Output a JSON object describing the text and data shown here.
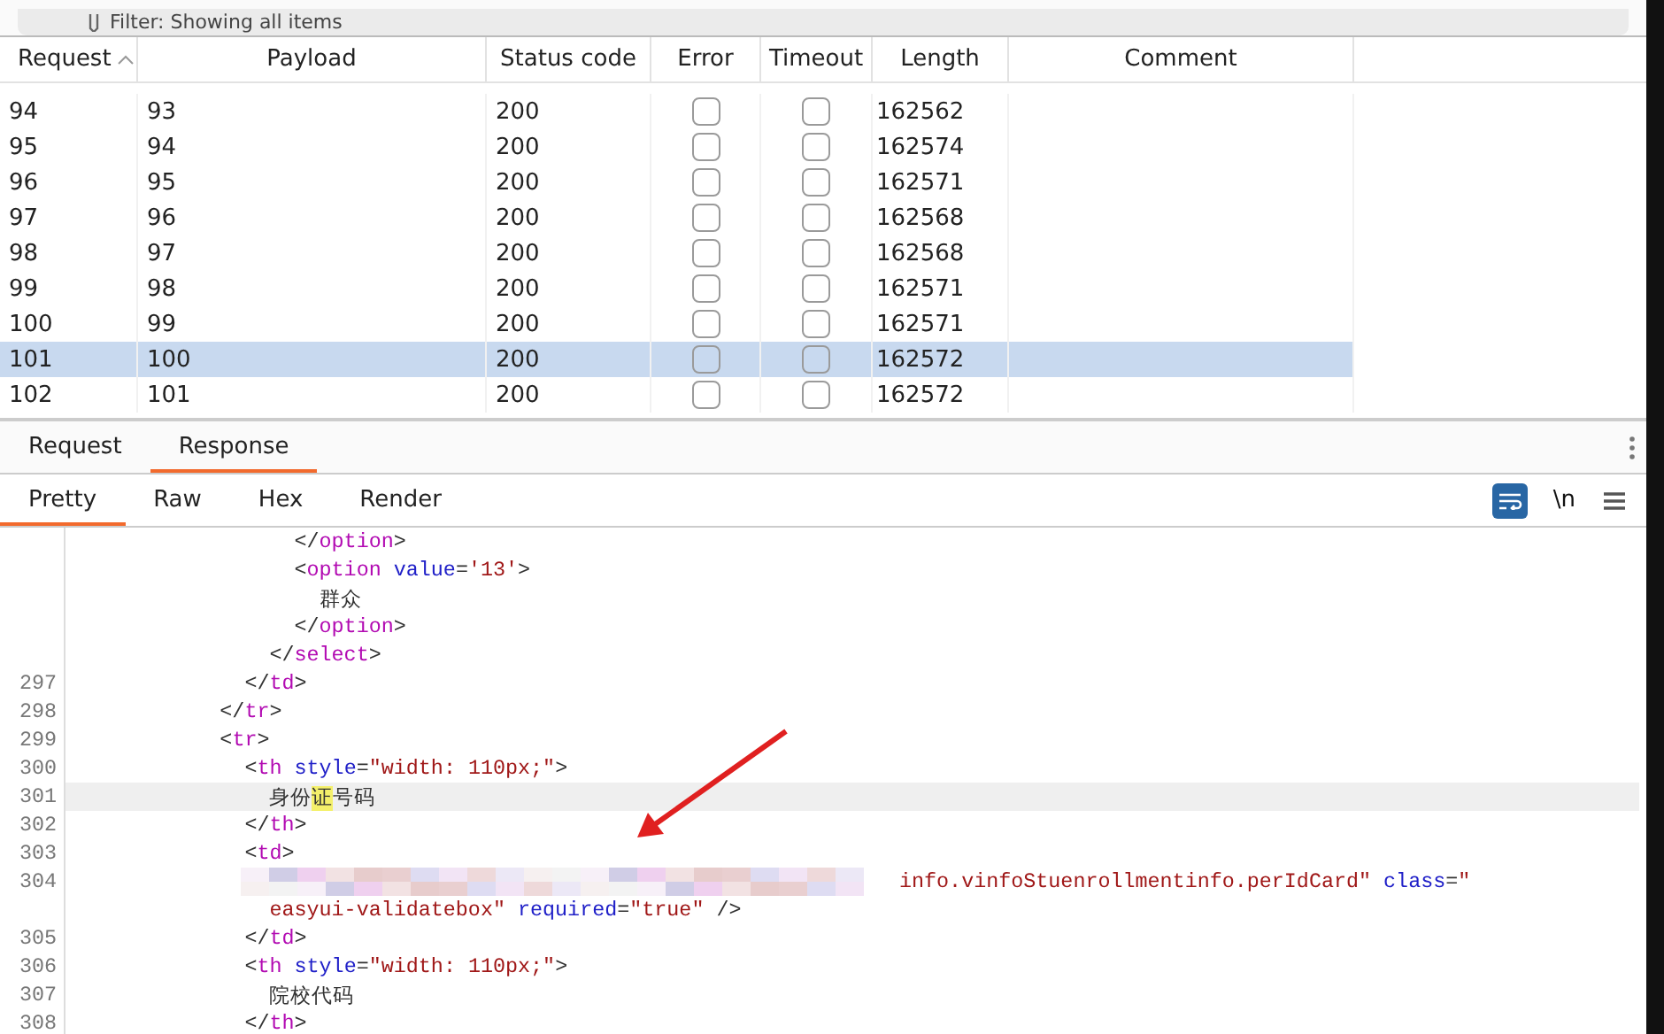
{
  "filter_bar": {
    "text": "Filter: Showing all items"
  },
  "table": {
    "columns": [
      {
        "label": "Request",
        "sorted": true
      },
      {
        "label": "Payload",
        "sorted": false
      },
      {
        "label": "Status code",
        "sorted": false
      },
      {
        "label": "Error",
        "sorted": false
      },
      {
        "label": "Timeout",
        "sorted": false
      },
      {
        "label": "Length",
        "sorted": false
      },
      {
        "label": "Comment",
        "sorted": false
      }
    ],
    "rows": [
      {
        "request": "94",
        "payload": "93",
        "status": "200",
        "error": false,
        "timeout": false,
        "length": "162562",
        "selected": false
      },
      {
        "request": "95",
        "payload": "94",
        "status": "200",
        "error": false,
        "timeout": false,
        "length": "162574",
        "selected": false
      },
      {
        "request": "96",
        "payload": "95",
        "status": "200",
        "error": false,
        "timeout": false,
        "length": "162571",
        "selected": false
      },
      {
        "request": "97",
        "payload": "96",
        "status": "200",
        "error": false,
        "timeout": false,
        "length": "162568",
        "selected": false
      },
      {
        "request": "98",
        "payload": "97",
        "status": "200",
        "error": false,
        "timeout": false,
        "length": "162568",
        "selected": false
      },
      {
        "request": "99",
        "payload": "98",
        "status": "200",
        "error": false,
        "timeout": false,
        "length": "162571",
        "selected": false
      },
      {
        "request": "100",
        "payload": "99",
        "status": "200",
        "error": false,
        "timeout": false,
        "length": "162571",
        "selected": false
      },
      {
        "request": "101",
        "payload": "100",
        "status": "200",
        "error": false,
        "timeout": false,
        "length": "162572",
        "selected": true
      },
      {
        "request": "102",
        "payload": "101",
        "status": "200",
        "error": false,
        "timeout": false,
        "length": "162572",
        "selected": false
      }
    ]
  },
  "message_tabs": [
    {
      "label": "Request",
      "selected": false
    },
    {
      "label": "Response",
      "selected": true
    }
  ],
  "view_tabs": [
    {
      "label": "Pretty",
      "selected": true
    },
    {
      "label": "Raw",
      "selected": false
    },
    {
      "label": "Hex",
      "selected": false
    },
    {
      "label": "Render",
      "selected": false
    }
  ],
  "view_toolbar": {
    "wrap_lines": {
      "on": true
    },
    "newline_toggle": {
      "label": "\\n",
      "on": false
    }
  },
  "code_lines": [
    {
      "current": false,
      "tokens": [
        {
          "kind": "punct",
          "text": "                  </"
        },
        {
          "kind": "tag",
          "text": "option"
        },
        {
          "kind": "punct",
          "text": ">"
        }
      ]
    },
    {
      "current": false,
      "tokens": [
        {
          "kind": "punct",
          "text": "                  <"
        },
        {
          "kind": "tag",
          "text": "option"
        },
        {
          "kind": "attr",
          "text": " value"
        },
        {
          "kind": "punct",
          "text": "="
        },
        {
          "kind": "value",
          "text": "'13'"
        },
        {
          "kind": "punct",
          "text": ">"
        }
      ]
    },
    {
      "current": false,
      "tokens": [
        {
          "kind": "plain",
          "text": "                    群众"
        }
      ]
    },
    {
      "current": false,
      "tokens": [
        {
          "kind": "punct",
          "text": "                  </"
        },
        {
          "kind": "tag",
          "text": "option"
        },
        {
          "kind": "punct",
          "text": ">"
        }
      ]
    },
    {
      "current": false,
      "tokens": [
        {
          "kind": "punct",
          "text": "                </"
        },
        {
          "kind": "tag",
          "text": "select"
        },
        {
          "kind": "punct",
          "text": ">"
        }
      ]
    },
    {
      "number": "297",
      "current": false,
      "tokens": [
        {
          "kind": "punct",
          "text": "              </"
        },
        {
          "kind": "tag",
          "text": "td"
        },
        {
          "kind": "punct",
          "text": ">"
        }
      ]
    },
    {
      "number": "298",
      "current": false,
      "tokens": [
        {
          "kind": "punct",
          "text": "            </"
        },
        {
          "kind": "tag",
          "text": "tr"
        },
        {
          "kind": "punct",
          "text": ">"
        }
      ]
    },
    {
      "number": "299",
      "current": false,
      "tokens": [
        {
          "kind": "punct",
          "text": "            <"
        },
        {
          "kind": "tag",
          "text": "tr"
        },
        {
          "kind": "punct",
          "text": ">"
        }
      ]
    },
    {
      "number": "300",
      "current": false,
      "tokens": [
        {
          "kind": "punct",
          "text": "              <"
        },
        {
          "kind": "tag",
          "text": "th"
        },
        {
          "kind": "attr",
          "text": " style"
        },
        {
          "kind": "punct",
          "text": "="
        },
        {
          "kind": "value",
          "text": "\"width: 110px;\""
        },
        {
          "kind": "punct",
          "text": ">"
        }
      ]
    },
    {
      "number": "301",
      "current": true,
      "tokens": [
        {
          "kind": "plain",
          "text": "                身份"
        },
        {
          "kind": "match",
          "text": "证"
        },
        {
          "kind": "plain",
          "text": "号码"
        }
      ]
    },
    {
      "number": "302",
      "current": false,
      "tokens": [
        {
          "kind": "punct",
          "text": "              </"
        },
        {
          "kind": "tag",
          "text": "th"
        },
        {
          "kind": "punct",
          "text": ">"
        }
      ]
    },
    {
      "number": "303",
      "current": false,
      "tokens": [
        {
          "kind": "punct",
          "text": "              <"
        },
        {
          "kind": "tag",
          "text": "td"
        },
        {
          "kind": "punct",
          "text": ">"
        }
      ]
    },
    {
      "number": "304",
      "current": false,
      "tokens": [
        {
          "kind": "redacted"
        },
        {
          "kind": "value",
          "text": "info.vinfoStuenrollmentinfo.perIdCard\""
        },
        {
          "kind": "attr",
          "text": " class"
        },
        {
          "kind": "punct",
          "text": "="
        },
        {
          "kind": "value",
          "text": "\""
        }
      ]
    },
    {
      "current": false,
      "tokens": [
        {
          "kind": "value",
          "text": "                easyui-validatebox\""
        },
        {
          "kind": "attr",
          "text": " required"
        },
        {
          "kind": "punct",
          "text": "="
        },
        {
          "kind": "value",
          "text": "\"true\""
        },
        {
          "kind": "punct",
          "text": " />"
        }
      ]
    },
    {
      "number": "305",
      "current": false,
      "tokens": [
        {
          "kind": "punct",
          "text": "              </"
        },
        {
          "kind": "tag",
          "text": "td"
        },
        {
          "kind": "punct",
          "text": ">"
        }
      ]
    },
    {
      "number": "306",
      "current": false,
      "tokens": [
        {
          "kind": "punct",
          "text": "              <"
        },
        {
          "kind": "tag",
          "text": "th"
        },
        {
          "kind": "attr",
          "text": " style"
        },
        {
          "kind": "punct",
          "text": "="
        },
        {
          "kind": "value",
          "text": "\"width: 110px;\""
        },
        {
          "kind": "punct",
          "text": ">"
        }
      ]
    },
    {
      "number": "307",
      "current": false,
      "tokens": [
        {
          "kind": "plain",
          "text": "                院校代码"
        }
      ]
    },
    {
      "number": "308",
      "current": false,
      "tokens": [
        {
          "kind": "punct",
          "text": "              </"
        },
        {
          "kind": "tag",
          "text": "th"
        },
        {
          "kind": "punct",
          "text": ">"
        }
      ]
    }
  ]
}
